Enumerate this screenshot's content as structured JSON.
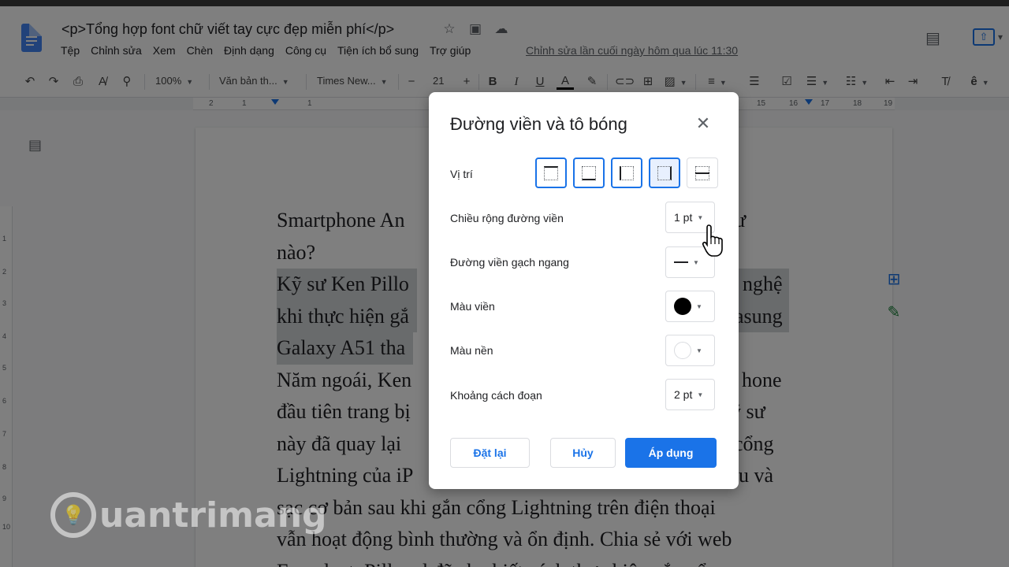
{
  "header": {
    "doc_title": "<p>Tổng hợp font chữ viết tay cực đẹp miễn phí</p>",
    "menu": [
      "Tệp",
      "Chỉnh sửa",
      "Xem",
      "Chèn",
      "Định dạng",
      "Công cụ",
      "Tiện ích bổ sung",
      "Trợ giúp"
    ],
    "last_edit": "Chỉnh sửa lần cuối ngày hôm qua lúc 11:30"
  },
  "toolbar": {
    "zoom": "100%",
    "style": "Văn bản th...",
    "font": "Times New...",
    "font_size": "21"
  },
  "ruler": {
    "ticks": [
      "2",
      "1",
      "1",
      "15",
      "16",
      "17",
      "18",
      "19"
    ]
  },
  "vruler": {
    "ticks": [
      "1",
      "2",
      "3",
      "4",
      "5",
      "6",
      "7",
      "8",
      "9",
      "10"
    ]
  },
  "document": {
    "lines": [
      {
        "text": "Smartphone An",
        "tail": "như",
        "highlight": false
      },
      {
        "text": "nào?",
        "tail": "",
        "highlight": false
      },
      {
        "text": "Kỹ sư Ken Pillo",
        "tail": "nghệ",
        "highlight": true
      },
      {
        "text": "khi thực hiện gắ",
        "tail": "asung",
        "highlight": true
      },
      {
        "text": "Galaxy A51 tha",
        "tail": "",
        "highlight": true
      },
      {
        "text": "Năm ngoái, Ken",
        "tail": "hone",
        "highlight": false
      },
      {
        "text": "đầu tiên trang bị",
        "tail": "kỹ sư",
        "highlight": false
      },
      {
        "text": "này đã quay lại",
        "tail": "cổng",
        "highlight": false
      },
      {
        "text": "Lightning của iP",
        "tail": "liệu và",
        "highlight": false
      },
      {
        "text": "sạc cơ bản sau khi gắn cổng Lightning trên điện thoại",
        "tail": "",
        "highlight": false
      },
      {
        "text": "vẫn hoạt động bình thường và ổn định. Chia sẻ với web",
        "tail": "",
        "highlight": false
      },
      {
        "text": "Engadget, Pillonel đã cho biết cách thực hiện gắn cổng",
        "tail": "",
        "highlight": false
      }
    ]
  },
  "dialog": {
    "title": "Đường viền và tô bóng",
    "position_label": "Vị trí",
    "border_width_label": "Chiều rộng đường viền",
    "border_width_value": "1 pt",
    "border_dash_label": "Đường viền gạch ngang",
    "border_color_label": "Màu viền",
    "border_color": "#000000",
    "background_color_label": "Màu nền",
    "background_color": "#ffffff",
    "padding_label": "Khoảng cách đoạn",
    "padding_value": "2 pt",
    "reset_label": "Đặt lại",
    "cancel_label": "Hủy",
    "apply_label": "Áp dụng"
  },
  "watermark": {
    "text": "uantrimang"
  },
  "colors": {
    "accent": "#1a73e8",
    "docs_blue": "#4285f4"
  }
}
